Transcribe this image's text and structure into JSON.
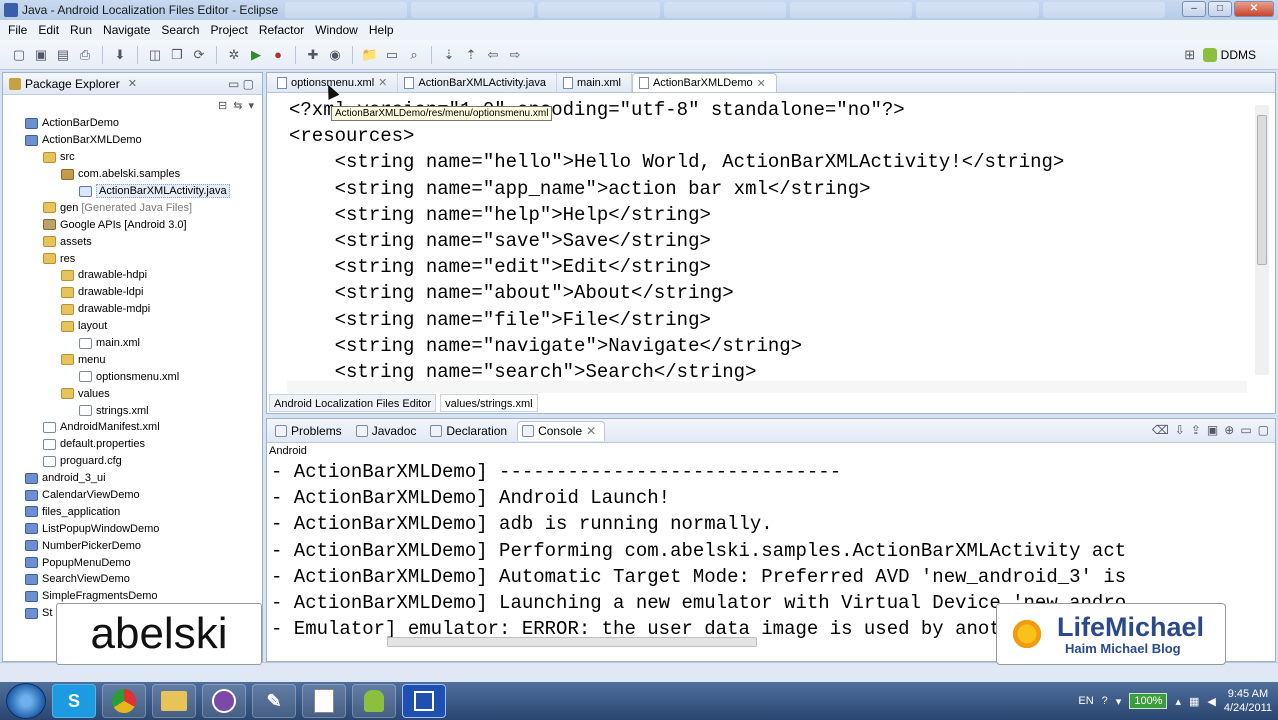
{
  "window": {
    "title": "Java - Android Localization Files Editor - Eclipse"
  },
  "menubar": [
    "File",
    "Edit",
    "Run",
    "Navigate",
    "Search",
    "Project",
    "Refactor",
    "Window",
    "Help"
  ],
  "perspective": {
    "label": "DDMS"
  },
  "package_explorer": {
    "title": "Package Explorer",
    "items": [
      {
        "label": "ActionBarDemo",
        "depth": 0,
        "icon": "project-icon"
      },
      {
        "label": "ActionBarXMLDemo",
        "depth": 0,
        "icon": "project-icon"
      },
      {
        "label": "src",
        "depth": 1,
        "icon": "folder-icon"
      },
      {
        "label": "com.abelski.samples",
        "depth": 2,
        "icon": "package-icon"
      },
      {
        "label": "ActionBarXMLActivity.java",
        "depth": 3,
        "icon": "java-file-icon",
        "selected": true
      },
      {
        "label": "gen",
        "depth": 1,
        "icon": "folder-icon",
        "note": "[Generated Java Files]"
      },
      {
        "label": "Google APIs [Android 3.0]",
        "depth": 1,
        "icon": "library-icon"
      },
      {
        "label": "assets",
        "depth": 1,
        "icon": "folder-icon"
      },
      {
        "label": "res",
        "depth": 1,
        "icon": "folder-icon"
      },
      {
        "label": "drawable-hdpi",
        "depth": 2,
        "icon": "folder-icon"
      },
      {
        "label": "drawable-ldpi",
        "depth": 2,
        "icon": "folder-icon"
      },
      {
        "label": "drawable-mdpi",
        "depth": 2,
        "icon": "folder-icon"
      },
      {
        "label": "layout",
        "depth": 2,
        "icon": "folder-icon"
      },
      {
        "label": "main.xml",
        "depth": 3,
        "icon": "xml-file-icon"
      },
      {
        "label": "menu",
        "depth": 2,
        "icon": "folder-icon"
      },
      {
        "label": "optionsmenu.xml",
        "depth": 3,
        "icon": "xml-file-icon"
      },
      {
        "label": "values",
        "depth": 2,
        "icon": "folder-icon"
      },
      {
        "label": "strings.xml",
        "depth": 3,
        "icon": "xml-file-icon"
      },
      {
        "label": "AndroidManifest.xml",
        "depth": 1,
        "icon": "xml-file-icon"
      },
      {
        "label": "default.properties",
        "depth": 1,
        "icon": "file-icon"
      },
      {
        "label": "proguard.cfg",
        "depth": 1,
        "icon": "file-icon"
      },
      {
        "label": "android_3_ui",
        "depth": 0,
        "icon": "project-icon"
      },
      {
        "label": "CalendarViewDemo",
        "depth": 0,
        "icon": "project-icon"
      },
      {
        "label": "files_application",
        "depth": 0,
        "icon": "project-icon"
      },
      {
        "label": "ListPopupWindowDemo",
        "depth": 0,
        "icon": "project-icon"
      },
      {
        "label": "NumberPickerDemo",
        "depth": 0,
        "icon": "project-icon"
      },
      {
        "label": "PopupMenuDemo",
        "depth": 0,
        "icon": "project-icon"
      },
      {
        "label": "SearchViewDemo",
        "depth": 0,
        "icon": "project-icon"
      },
      {
        "label": "SimpleFragmentsDemo",
        "depth": 0,
        "icon": "project-icon"
      },
      {
        "label": "St",
        "depth": 0,
        "icon": "project-icon"
      }
    ]
  },
  "editor": {
    "tabs": [
      {
        "label": "optionsmenu.xml",
        "active": false
      },
      {
        "label": "ActionBarXMLActivity.java",
        "active": false
      },
      {
        "label": "main.xml",
        "active": false
      },
      {
        "label": "ActionBarXMLDemo",
        "active": true
      }
    ],
    "tooltip": "ActionBarXMLDemo/res/menu/optionsmenu.xml",
    "code_lines": [
      "<?xml version=\"1.0\" encoding=\"utf-8\" standalone=\"no\"?>",
      "<resources>",
      "    <string name=\"hello\">Hello World, ActionBarXMLActivity!</string>",
      "    <string name=\"app_name\">action bar xml</string>",
      "    <string name=\"help\">Help</string>",
      "    <string name=\"save\">Save</string>",
      "    <string name=\"edit\">Edit</string>",
      "    <string name=\"about\">About</string>",
      "    <string name=\"file\">File</string>",
      "    <string name=\"navigate\">Navigate</string>",
      "    <string name=\"search\">Search</string>"
    ],
    "bottom_tabs": [
      {
        "label": "Android Localization Files Editor",
        "active": false
      },
      {
        "label": "values/strings.xml",
        "active": true
      }
    ]
  },
  "console": {
    "tabs": [
      {
        "label": "Problems",
        "active": false
      },
      {
        "label": "Javadoc",
        "active": false
      },
      {
        "label": "Declaration",
        "active": false
      },
      {
        "label": "Console",
        "active": true
      }
    ],
    "label": "Android",
    "lines": [
      "- ActionBarXMLDemo] ------------------------------",
      "- ActionBarXMLDemo] Android Launch!",
      "- ActionBarXMLDemo] adb is running normally.",
      "- ActionBarXMLDemo] Performing com.abelski.samples.ActionBarXMLActivity act",
      "- ActionBarXMLDemo] Automatic Target Mode: Preferred AVD 'new_android_3' is",
      "- ActionBarXMLDemo] Launching a new emulator with Virtual Device 'new_andro",
      "- Emulator] emulator: ERROR: the user data image is used by another emulato"
    ]
  },
  "overlays": {
    "left_brand": "abelski",
    "right_brand": "LifeMichael",
    "right_sub": "Haim Michael Blog"
  },
  "taskbar": {
    "apps": [
      "skype-icon",
      "chrome-icon",
      "explorer-icon",
      "app-icon",
      "paint-icon",
      "pdf-icon",
      "android-icon",
      "eclipse-icon"
    ],
    "skype_letter": "S",
    "language": "EN",
    "battery": "100%",
    "time": "9:45 AM",
    "date": "4/24/2011"
  }
}
